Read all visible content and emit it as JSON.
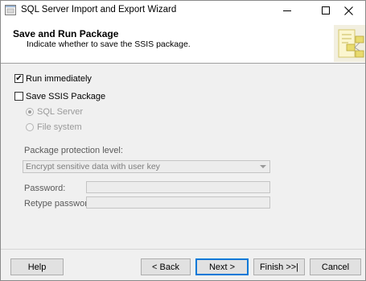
{
  "window": {
    "title": "SQL Server Import and Export Wizard"
  },
  "header": {
    "title": "Save and Run Package",
    "subtitle": "Indicate whether to save the SSIS package."
  },
  "options": {
    "run_immediately": {
      "label": "Run immediately",
      "checked": true
    },
    "save_ssis": {
      "label": "Save SSIS Package",
      "checked": false
    },
    "location": {
      "sql_server": {
        "label": "SQL Server",
        "selected": true,
        "enabled": false
      },
      "file_system": {
        "label": "File system",
        "selected": false,
        "enabled": false
      }
    }
  },
  "protection": {
    "label": "Package protection level:",
    "value": "Encrypt sensitive data with user key"
  },
  "password": {
    "label": "Password:",
    "value": ""
  },
  "retype_password": {
    "label": "Retype password:",
    "value": ""
  },
  "buttons": {
    "help": "Help",
    "back": "< Back",
    "next": "Next >",
    "finish": "Finish >>|",
    "cancel": "Cancel"
  },
  "icons": {
    "app": "wizard-app-icon",
    "minimize": "minimize-icon",
    "maximize": "maximize-icon",
    "close": "close-icon",
    "header": "package-header-graphic",
    "checkmark": "✔"
  }
}
